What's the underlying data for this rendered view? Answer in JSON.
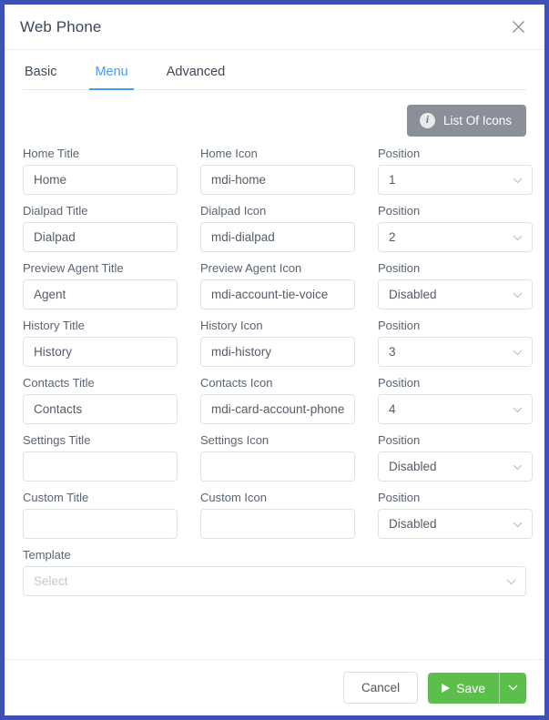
{
  "dialog": {
    "title": "Web Phone",
    "close_icon": "close-icon"
  },
  "tabs": [
    {
      "label": "Basic",
      "active": false
    },
    {
      "label": "Menu",
      "active": true
    },
    {
      "label": "Advanced",
      "active": false
    }
  ],
  "toolbar": {
    "list_of_icons_label": "List Of Icons",
    "info_icon_glyph": "i"
  },
  "form": {
    "rows": [
      {
        "title_label": "Home Title",
        "title_value": "Home",
        "icon_label": "Home Icon",
        "icon_value": "mdi-home",
        "position_label": "Position",
        "position_value": "1"
      },
      {
        "title_label": "Dialpad Title",
        "title_value": "Dialpad",
        "icon_label": "Dialpad Icon",
        "icon_value": "mdi-dialpad",
        "position_label": "Position",
        "position_value": "2"
      },
      {
        "title_label": "Preview Agent Title",
        "title_value": "Agent",
        "icon_label": "Preview Agent Icon",
        "icon_value": "mdi-account-tie-voice",
        "position_label": "Position",
        "position_value": "Disabled"
      },
      {
        "title_label": "History Title",
        "title_value": "History",
        "icon_label": "History Icon",
        "icon_value": "mdi-history",
        "position_label": "Position",
        "position_value": "3"
      },
      {
        "title_label": "Contacts Title",
        "title_value": "Contacts",
        "icon_label": "Contacts Icon",
        "icon_value": "mdi-card-account-phone",
        "position_label": "Position",
        "position_value": "4"
      },
      {
        "title_label": "Settings Title",
        "title_value": "",
        "icon_label": "Settings Icon",
        "icon_value": "",
        "position_label": "Position",
        "position_value": "Disabled"
      },
      {
        "title_label": "Custom Title",
        "title_value": "",
        "icon_label": "Custom Icon",
        "icon_value": "",
        "position_label": "Position",
        "position_value": "Disabled"
      }
    ],
    "template": {
      "label": "Template",
      "placeholder": "Select",
      "value": ""
    }
  },
  "footer": {
    "cancel_label": "Cancel",
    "save_label": "Save"
  },
  "colors": {
    "dialog_border": "#3f51b5",
    "active_tab": "#4a9bf5",
    "save_green": "#5cbf4b",
    "list_icons_gray": "#8a8f98"
  }
}
